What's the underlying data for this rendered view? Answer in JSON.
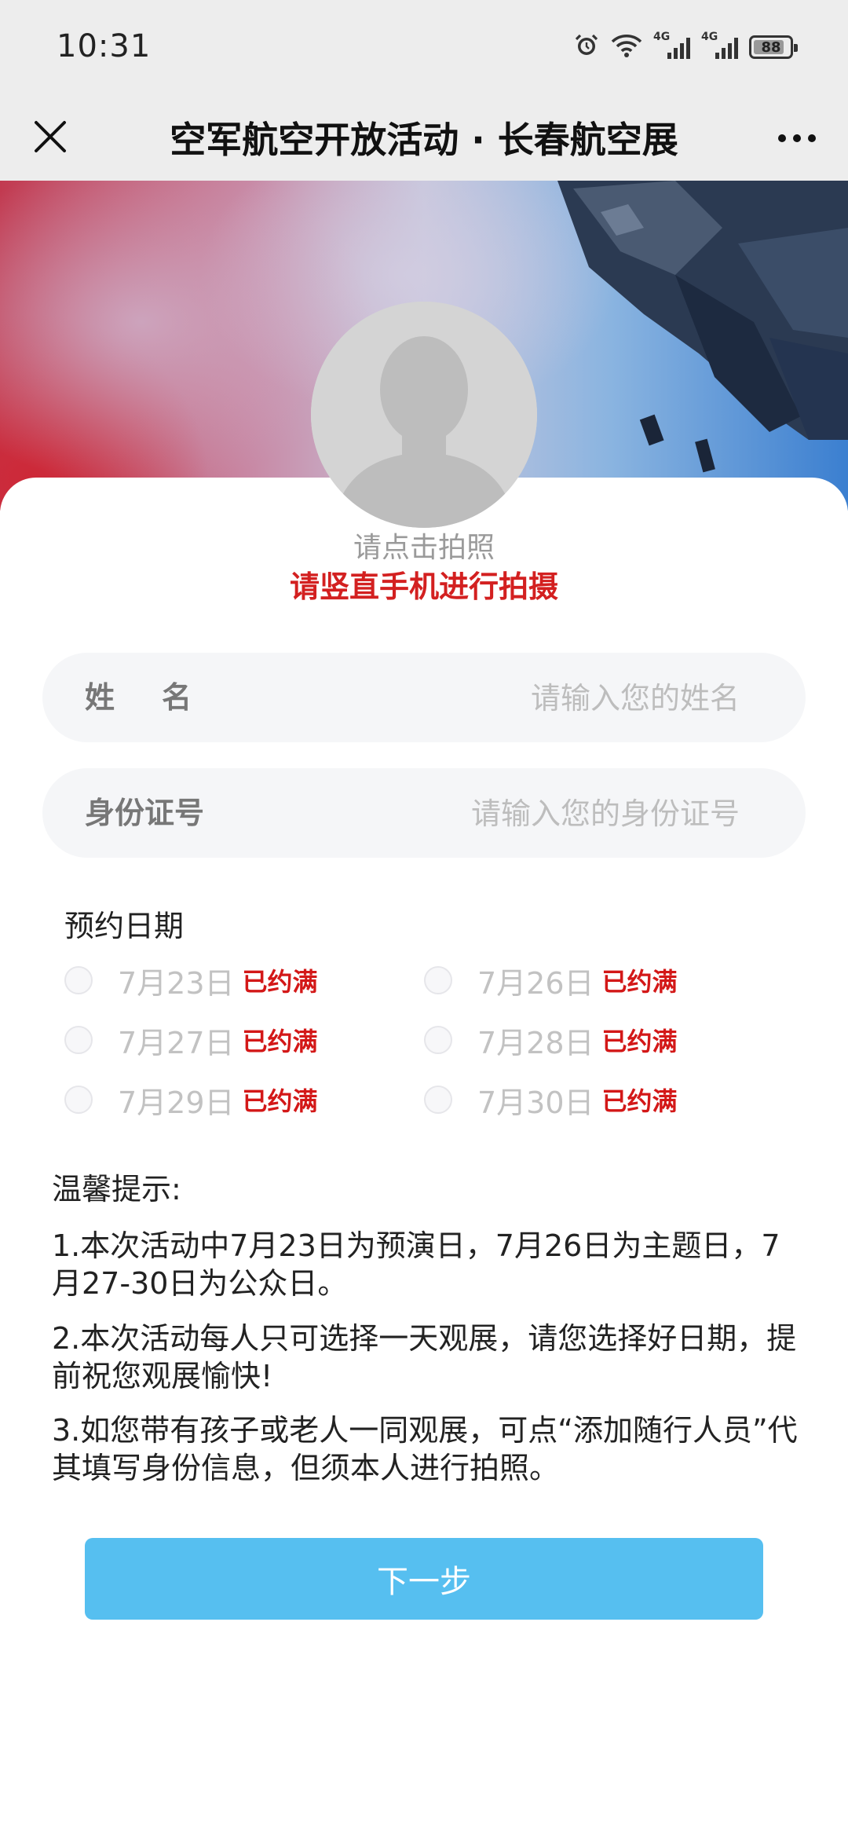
{
  "status_bar": {
    "time": "10:31",
    "network1": "4G",
    "network2": "4G",
    "battery": "88",
    "icons": [
      "alarm-icon",
      "wifi-icon",
      "signal-icon",
      "signal-icon",
      "battery-icon"
    ]
  },
  "nav": {
    "title": "空军航空开放活动 · 长春航空展",
    "close_icon": "close-icon",
    "more_icon": "more-icon"
  },
  "photo": {
    "hint": "请点击拍照",
    "warning": "请竖直手机进行拍摄"
  },
  "form": {
    "name_label": "姓名",
    "name_placeholder": "请输入您的姓名",
    "id_label": "身份证号",
    "id_placeholder": "请输入您的身份证号"
  },
  "dates": {
    "title": "预约日期",
    "options": [
      {
        "date": "7月23日",
        "status": "已约满"
      },
      {
        "date": "7月26日",
        "status": "已约满"
      },
      {
        "date": "7月27日",
        "status": "已约满"
      },
      {
        "date": "7月28日",
        "status": "已约满"
      },
      {
        "date": "7月29日",
        "status": "已约满"
      },
      {
        "date": "7月30日",
        "status": "已约满"
      }
    ]
  },
  "tips": {
    "title": "温馨提示:",
    "items": [
      "1.本次活动中7月23日为预演日，7月26日为主题日，7月27-30日为公众日。",
      "2.本次活动每人只可选择一天观展，请您选择好日期，提前祝您观展愉快!",
      "3.如您带有孩子或老人一同观展，可点“添加随行人员”代其填写身份信息，但须本人进行拍照。"
    ]
  },
  "next_button": "下一步",
  "colors": {
    "accent_button": "#56bff0",
    "warning_red": "#d32020"
  }
}
